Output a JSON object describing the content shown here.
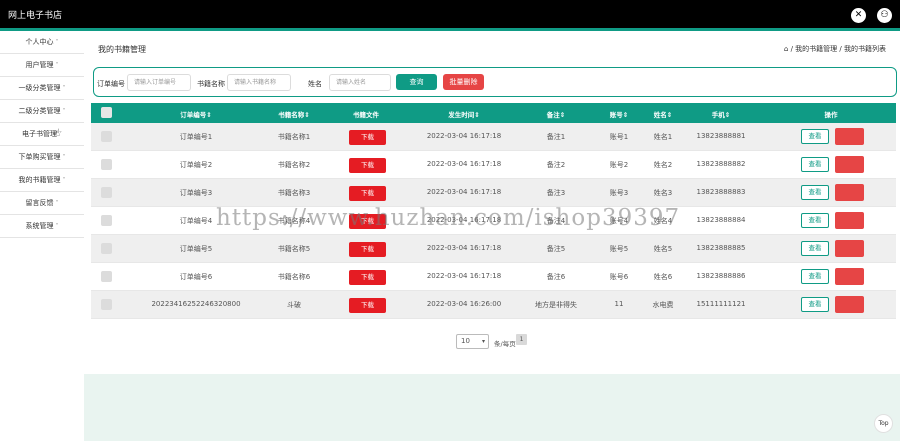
{
  "app": {
    "title": "网上电子书店"
  },
  "topbar": {
    "fullscreen_icon": "✕",
    "user_icon": "⚇"
  },
  "sidebar": {
    "items": [
      {
        "label": "个人中心"
      },
      {
        "label": "用户管理"
      },
      {
        "label": "一级分类管理"
      },
      {
        "label": "二级分类管理"
      },
      {
        "label": "电子书管理"
      },
      {
        "label": "下单购买管理"
      },
      {
        "label": "我的书籍管理"
      },
      {
        "label": "留言反馈"
      },
      {
        "label": "系统管理"
      }
    ],
    "chevron": "˅"
  },
  "page": {
    "title": "我的书籍管理",
    "breadcrumb_home_icon": "⌂",
    "breadcrumb": "/ 我的书籍管理 / 我的书籍列表"
  },
  "search": {
    "order_label": "订单编号",
    "order_placeholder": "请输入订单编号",
    "book_label": "书籍名称",
    "book_placeholder": "请输入书籍名称",
    "name_label": "姓名",
    "name_placeholder": "请输入姓名",
    "query_button": "查询",
    "batch_delete_button": "批量删除"
  },
  "table": {
    "headers": [
      "订单编号⇕",
      "书籍名称⇕",
      "书籍文件",
      "发生时间⇕",
      "备注⇕",
      "账号⇕",
      "姓名⇕",
      "手机⇕",
      "操作"
    ],
    "download_label": "下载",
    "view_label": "查看",
    "rows": [
      {
        "order": "订单编号1",
        "book": "书籍名称1",
        "time": "2022-03-04 16:17:18",
        "note": "备注1",
        "account": "账号1",
        "name": "姓名1",
        "phone": "13823888881"
      },
      {
        "order": "订单编号2",
        "book": "书籍名称2",
        "time": "2022-03-04 16:17:18",
        "note": "备注2",
        "account": "账号2",
        "name": "姓名2",
        "phone": "13823888882"
      },
      {
        "order": "订单编号3",
        "book": "书籍名称3",
        "time": "2022-03-04 16:17:18",
        "note": "备注3",
        "account": "账号3",
        "name": "姓名3",
        "phone": "13823888883"
      },
      {
        "order": "订单编号4",
        "book": "书籍名称4",
        "time": "2022-03-04 16:17:18",
        "note": "备注4",
        "account": "账号4",
        "name": "姓名4",
        "phone": "13823888884"
      },
      {
        "order": "订单编号5",
        "book": "书籍名称5",
        "time": "2022-03-04 16:17:18",
        "note": "备注5",
        "account": "账号5",
        "name": "姓名5",
        "phone": "13823888885"
      },
      {
        "order": "订单编号6",
        "book": "书籍名称6",
        "time": "2022-03-04 16:17:18",
        "note": "备注6",
        "account": "账号6",
        "name": "姓名6",
        "phone": "13823888886"
      },
      {
        "order": "20223416252246320800",
        "book": "斗破",
        "time": "2022-03-04 16:26:00",
        "note": "地方是非得失",
        "account": "11",
        "name": "水电费",
        "phone": "15111111121"
      }
    ]
  },
  "pager": {
    "page_size": "10",
    "per_page_label": "条/每页",
    "current_page": "1"
  },
  "watermark": "https://www.huzhan.com/ishop39397",
  "top_button": "Top",
  "colors": {
    "accent": "#0f9b85",
    "danger": "#e64545",
    "download": "#e51c23"
  }
}
